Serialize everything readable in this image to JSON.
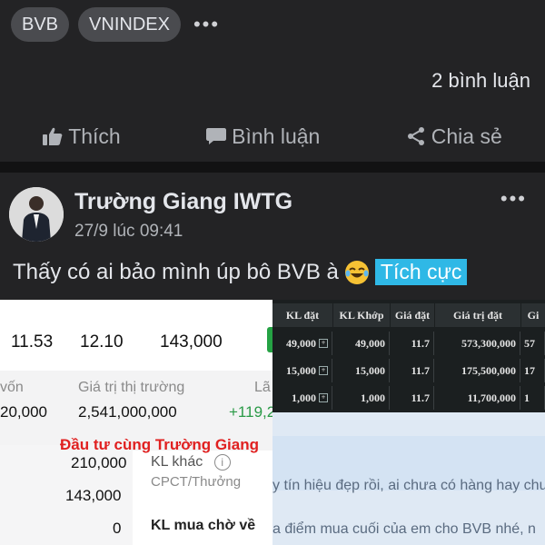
{
  "tags": [
    "BVB",
    "VNINDEX"
  ],
  "more_glyph": "•••",
  "comments_count": "2 bình luận",
  "actions": {
    "like": "Thích",
    "comment": "Bình luận",
    "share": "Chia sẻ"
  },
  "post": {
    "author": "Trường Giang IWTG",
    "time": "27/9 lúc 09:41",
    "text": "Thấy có ai bảo mình úp bô BVB à",
    "badge": "Tích cực"
  },
  "left_image": {
    "prices": [
      "11.53",
      "12.10",
      "143,000"
    ],
    "labels": {
      "von": "vốn",
      "market_value": "Giá trị thị trường",
      "la": "Lã"
    },
    "values": {
      "von_value": "20,000",
      "market_value": "2,541,000,000",
      "change": "+119,2"
    },
    "watermark": "Đầu tư cùng Trường Giang",
    "rows": [
      "210,000",
      "143,000",
      "0"
    ],
    "side_labels": {
      "kl_khac": "KL khác",
      "cpct": "CPCT/Thưởng",
      "kl_mua": "KL mua chờ về"
    }
  },
  "right_image": {
    "headers": [
      "KL đặt",
      "KL Khớp",
      "Giá đặt",
      "Giá trị đặt",
      "Gi"
    ],
    "rows": [
      [
        "49,000",
        "49,000",
        "11.7",
        "573,300,000",
        "57"
      ],
      [
        "15,000",
        "15,000",
        "11.7",
        "175,500,000",
        "17"
      ],
      [
        "1,000",
        "1,000",
        "11.7",
        "11,700,000",
        "1"
      ]
    ],
    "chat_line_1": "y tín hiệu đẹp rồi, ai chưa có hàng hay chư",
    "chat_line_2": "a điểm mua cuối của em cho BVB nhé, n"
  }
}
